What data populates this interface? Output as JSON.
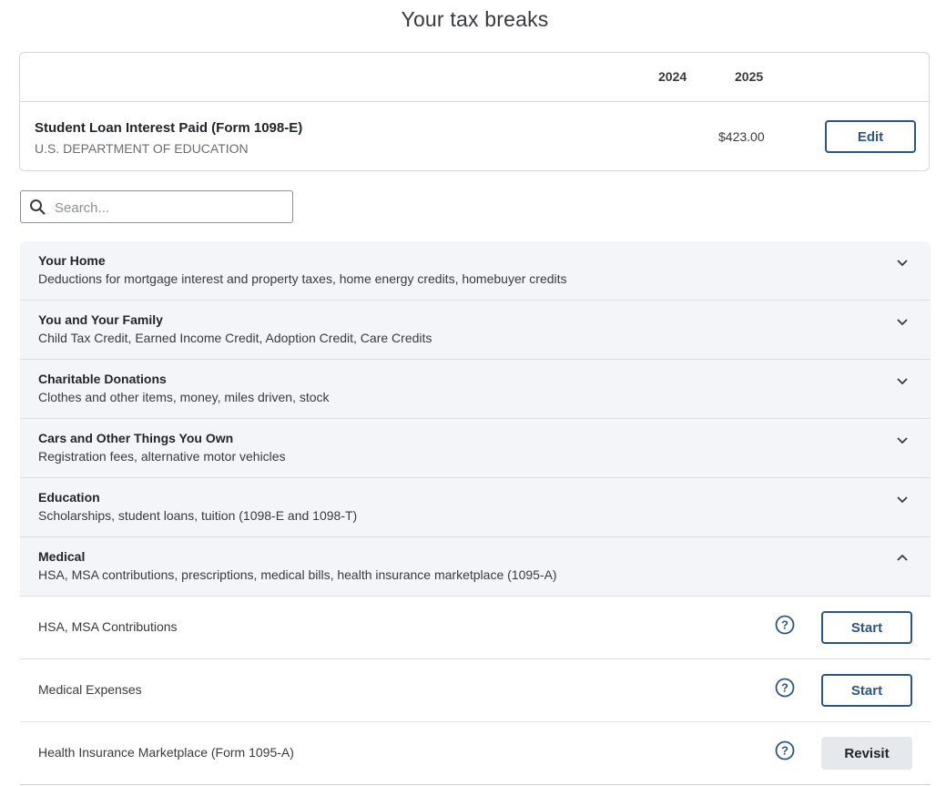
{
  "page": {
    "title": "Your tax breaks"
  },
  "summary": {
    "years": [
      "2024",
      "2025"
    ],
    "item": {
      "title": "Student Loan Interest Paid (Form 1098-E)",
      "subtitle": "U.S. DEPARTMENT OF EDUCATION",
      "amount_2024": "$423.00",
      "edit_label": "Edit"
    }
  },
  "search": {
    "placeholder": "Search...",
    "value": ""
  },
  "categories": [
    {
      "title": "Your Home",
      "description": "Deductions for mortgage interest and property taxes, home energy credits, homebuyer credits",
      "expanded": false
    },
    {
      "title": "You and Your Family",
      "description": "Child Tax Credit, Earned Income Credit, Adoption Credit, Care Credits",
      "expanded": false
    },
    {
      "title": "Charitable Donations",
      "description": "Clothes and other items, money, miles driven, stock",
      "expanded": false
    },
    {
      "title": "Cars and Other Things You Own",
      "description": "Registration fees, alternative motor vehicles",
      "expanded": false
    },
    {
      "title": "Education",
      "description": "Scholarships, student loans, tuition (1098-E and 1098-T)",
      "expanded": false
    },
    {
      "title": "Medical",
      "description": "HSA, MSA contributions, prescriptions, medical bills, health insurance marketplace (1095-A)",
      "expanded": true
    }
  ],
  "medical_items": [
    {
      "label": "HSA, MSA Contributions",
      "action": "Start"
    },
    {
      "label": "Medical Expenses",
      "action": "Start"
    },
    {
      "label": "Health Insurance Marketplace (Form 1095-A)",
      "action": "Revisit"
    }
  ],
  "colors": {
    "accent": "#2b5784",
    "panel": "#f4f5f8",
    "border": "#d4d7dc"
  },
  "icons": {
    "search": "search-icon",
    "collapsed": "chevron-down-icon",
    "expanded": "chevron-up-icon",
    "help": "help-circle-icon"
  }
}
